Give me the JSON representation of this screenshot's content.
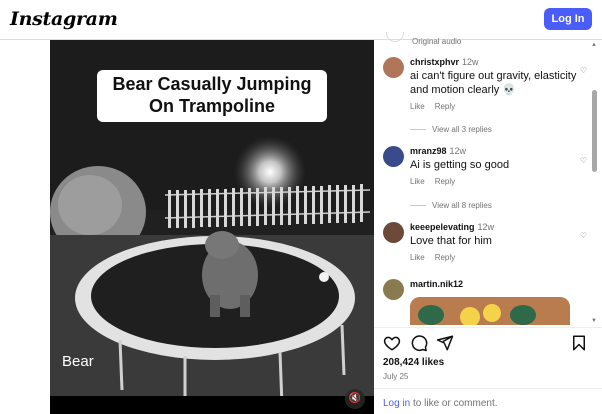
{
  "header": {
    "logo": "Instagram",
    "login_button": "Log In"
  },
  "media": {
    "caption": "Bear Casually Jumping On Trampoline",
    "overlay_label": "Bear",
    "mute_icon": "muted-speaker-icon"
  },
  "audio": {
    "label": "Original audio"
  },
  "comments": [
    {
      "user": "christxphvr",
      "time": "12w",
      "text": "ai can't figure out gravity, elasticity and motion clearly 💀",
      "like": "Like",
      "reply": "Reply",
      "replies": "View all 3 replies",
      "avatar_color": "#b0765a"
    },
    {
      "user": "mranz98",
      "time": "12w",
      "text": "Ai is getting so good",
      "like": "Like",
      "reply": "Reply",
      "replies": "View all 8 replies",
      "avatar_color": "#3b4a8a"
    },
    {
      "user": "keeepelevating",
      "time": "12w",
      "text": "Love that for him",
      "like": "Like",
      "reply": "Reply",
      "avatar_color": "#6b4a3a"
    },
    {
      "user": "martin.nik12",
      "avatar_color": "#8a7a50"
    }
  ],
  "post": {
    "likes": "208,424 likes",
    "date": "July 25",
    "login_link": "Log in",
    "login_suffix": " to like or comment."
  },
  "icons": {
    "like": "heart-icon",
    "comment": "comment-icon",
    "share": "share-icon",
    "save": "bookmark-icon"
  },
  "colors": {
    "accent": "#4a5df9",
    "muted_text": "#737373"
  }
}
